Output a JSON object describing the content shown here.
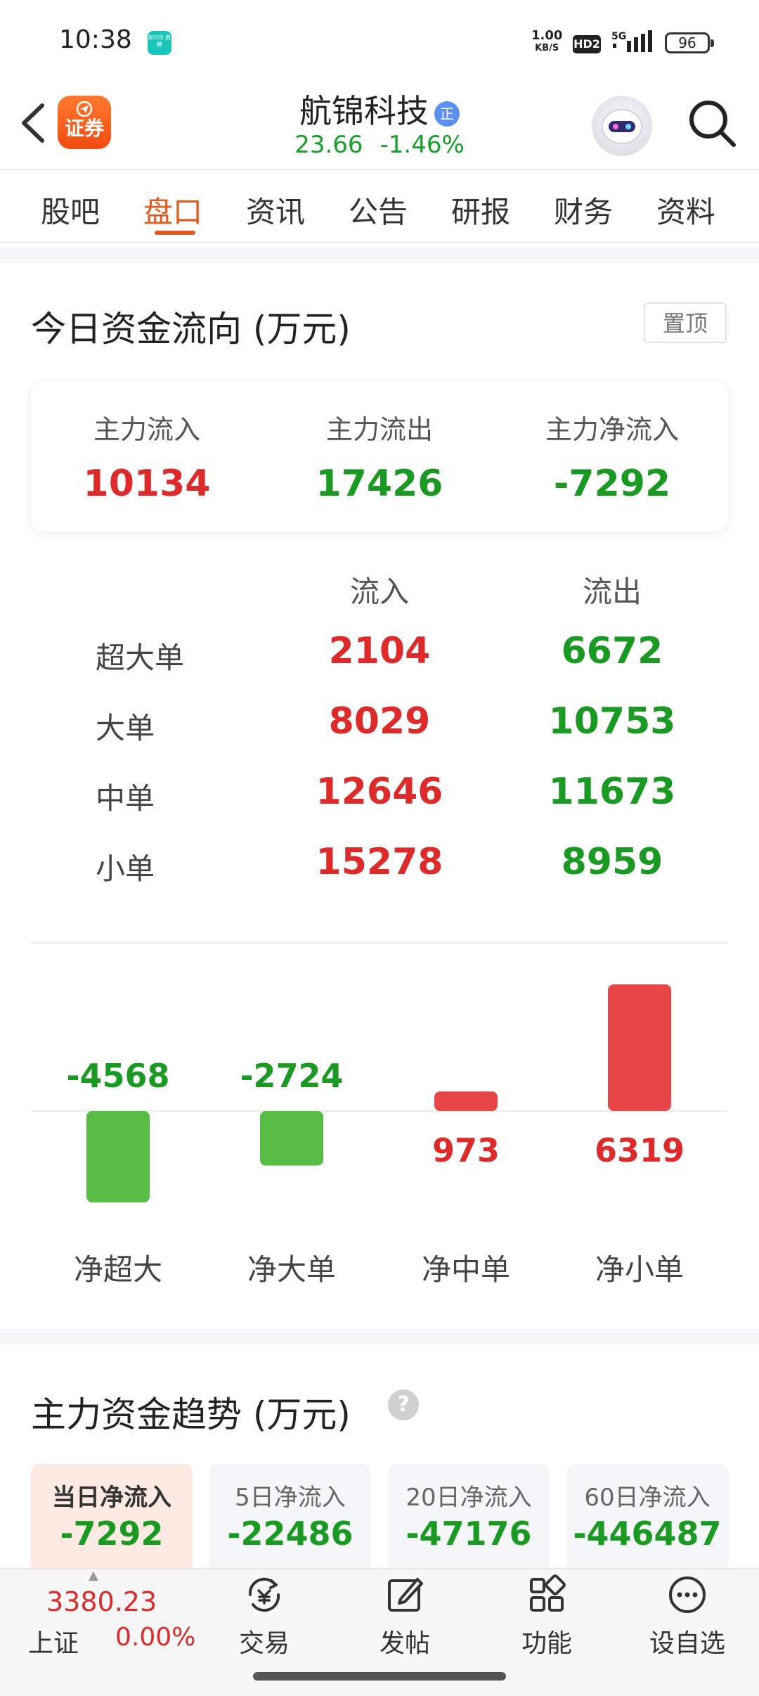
{
  "status_bar": {
    "time": "10:38",
    "app_badge": "BOSS 直聘",
    "net_speed_value": "1.00",
    "net_speed_unit": "KB/S",
    "hd_label": "HD2",
    "network_type": "5G",
    "battery": "96"
  },
  "header": {
    "app_logo_label": "证券",
    "stock_name": "航锦科技",
    "verified_badge": "正",
    "price": "23.66",
    "change_pct": "-1.46%"
  },
  "tabs": [
    {
      "label": "股吧",
      "active": false
    },
    {
      "label": "盘口",
      "active": true
    },
    {
      "label": "资讯",
      "active": false
    },
    {
      "label": "公告",
      "active": false
    },
    {
      "label": "研报",
      "active": false
    },
    {
      "label": "财务",
      "active": false
    },
    {
      "label": "资料",
      "active": false
    }
  ],
  "flow": {
    "title": "今日资金流向 (万元)",
    "pin_label": "置顶",
    "summary": [
      {
        "label": "主力流入",
        "value": "10134",
        "color": "#dd2b2b"
      },
      {
        "label": "主力流出",
        "value": "17426",
        "color": "#1a9a23"
      },
      {
        "label": "主力净流入",
        "value": "-7292",
        "color": "#1a9a23"
      }
    ],
    "table": {
      "headers": [
        "流入",
        "流出"
      ],
      "rows": [
        {
          "label": "超大单",
          "inflow": "2104",
          "outflow": "6672"
        },
        {
          "label": "大单",
          "inflow": "8029",
          "outflow": "10753"
        },
        {
          "label": "中单",
          "inflow": "12646",
          "outflow": "11673"
        },
        {
          "label": "小单",
          "inflow": "15278",
          "outflow": "8959"
        }
      ]
    }
  },
  "chart_data": {
    "type": "bar",
    "categories": [
      "净超大",
      "净大单",
      "净中单",
      "净小单"
    ],
    "values": [
      -4568,
      -2724,
      973,
      6319
    ],
    "positive_color": "#e84646",
    "negative_color": "#57bd45",
    "grid": false
  },
  "trend": {
    "title": "主力资金趋势 (万元)",
    "help_icon": "question-icon",
    "tabs": [
      {
        "label": "当日净流入",
        "value": "-7292",
        "active": true
      },
      {
        "label": "5日净流入",
        "value": "-22486",
        "active": false
      },
      {
        "label": "20日净流入",
        "value": "-47176",
        "active": false
      },
      {
        "label": "60日净流入",
        "value": "-446487",
        "active": false
      }
    ]
  },
  "bottom_nav": {
    "index_value": "3380.23",
    "index_name": "上证",
    "index_change": "0.00%",
    "items": [
      {
        "label": "交易",
        "icon": "yuan-exchange-icon"
      },
      {
        "label": "发帖",
        "icon": "edit-post-icon"
      },
      {
        "label": "功能",
        "icon": "grid-apps-icon"
      },
      {
        "label": "设自选",
        "icon": "more-dots-icon"
      }
    ]
  }
}
